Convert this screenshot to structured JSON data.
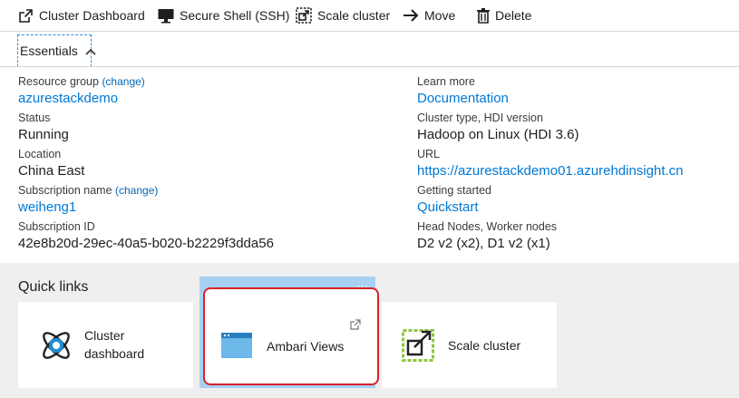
{
  "toolbar": {
    "cluster_dashboard": "Cluster Dashboard",
    "secure_shell": "Secure Shell (SSH)",
    "scale_cluster": "Scale cluster",
    "move": "Move",
    "delete": "Delete"
  },
  "essentials": {
    "label": "Essentials"
  },
  "left_props": {
    "resource_group_label": "Resource group",
    "resource_group_change": "(change)",
    "resource_group_value": "azurestackdemo",
    "status_label": "Status",
    "status_value": "Running",
    "location_label": "Location",
    "location_value": "China East",
    "subscription_name_label": "Subscription name",
    "subscription_name_change": "(change)",
    "subscription_name_value": "weiheng1",
    "subscription_id_label": "Subscription ID",
    "subscription_id_value": "42e8b20d-29ec-40a5-b020-b2229f3dda56"
  },
  "right_props": {
    "learn_more_label": "Learn more",
    "learn_more_value": "Documentation",
    "cluster_type_label": "Cluster type, HDI version",
    "cluster_type_value": "Hadoop on Linux (HDI 3.6)",
    "url_label": "URL",
    "url_value": "https://azurestackdemo01.azurehdinsight.cn",
    "getting_started_label": "Getting started",
    "getting_started_value": "Quickstart",
    "nodes_label": "Head Nodes, Worker nodes",
    "nodes_value": "D2 v2 (x2), D1 v2 (x1)"
  },
  "quick_links": {
    "title": "Quick links",
    "cluster_dashboard_line1": "Cluster",
    "cluster_dashboard_line2": "dashboard",
    "ambari_views": "Ambari Views",
    "scale_cluster": "Scale cluster",
    "tile_menu": "···"
  },
  "colors": {
    "link": "#0078d4",
    "highlight_border": "#d9222a",
    "hover_strip": "#a7d1f2"
  }
}
